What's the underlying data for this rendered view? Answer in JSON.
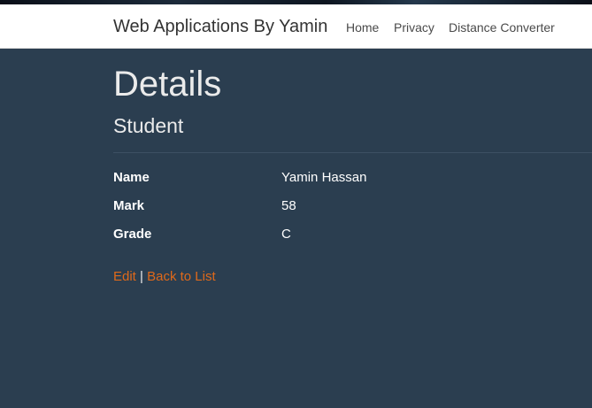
{
  "navbar": {
    "brand": "Web Applications By Yamin",
    "links": [
      "Home",
      "Privacy",
      "Distance Converter"
    ]
  },
  "page": {
    "title": "Details",
    "subtitle": "Student"
  },
  "details": [
    {
      "label": "Name",
      "value": "Yamin Hassan"
    },
    {
      "label": "Mark",
      "value": "58"
    },
    {
      "label": "Grade",
      "value": "C"
    }
  ],
  "actions": {
    "edit": "Edit",
    "separator": "|",
    "back": "Back to List"
  },
  "colors": {
    "background": "#2b3e50",
    "link": "#df691a",
    "navbar": "#ffffff"
  }
}
